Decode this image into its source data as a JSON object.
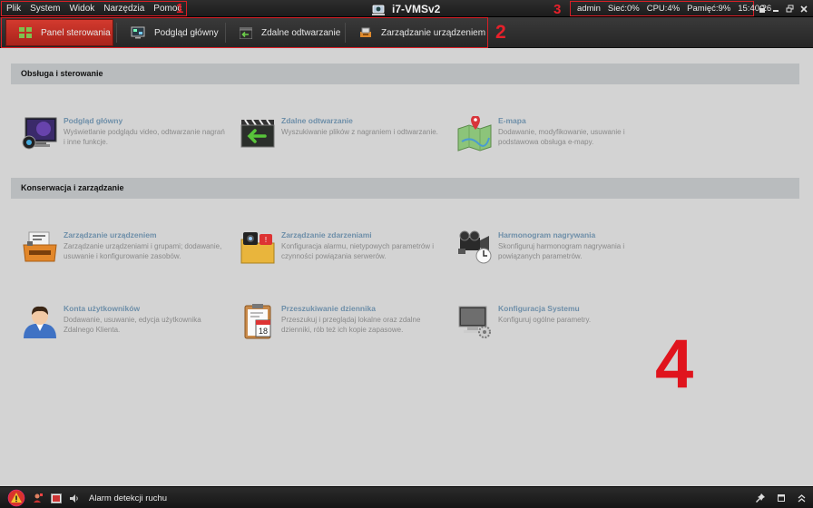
{
  "menu": {
    "items": [
      "Plik",
      "System",
      "Widok",
      "Narzędzia",
      "Pomoc"
    ],
    "annotation": "1"
  },
  "app": {
    "title": "i7-VMSv2"
  },
  "status": {
    "annotation": "3",
    "user": "admin",
    "net": "Sieć:0%",
    "cpu": "CPU:4%",
    "mem": "Pamięć:9%",
    "time": "15:40:26"
  },
  "window_controls": {
    "lock_icon": "lock-icon",
    "minimize_icon": "minimize-icon",
    "restore_icon": "restore-icon",
    "close_icon": "close-icon"
  },
  "tabs": {
    "annotation": "2",
    "items": [
      {
        "label": "Panel sterowania",
        "icon": "grid-icon",
        "active": true
      },
      {
        "label": "Podgląd główny",
        "icon": "monitor-icon",
        "active": false
      },
      {
        "label": "Zdalne odtwarzanie",
        "icon": "playback-icon",
        "active": false
      },
      {
        "label": "Zarządzanie urządzeniem",
        "icon": "device-icon",
        "active": false
      }
    ],
    "active_color": "#c0302a"
  },
  "sections": [
    {
      "title": "Obsługa i sterowanie",
      "items": [
        {
          "title": "Podgląd główny",
          "desc": "Wyświetlanie podglądu video, odtwarzanie nagrań i inne funkcje.",
          "icon": "live-view-icon"
        },
        {
          "title": "Zdalne odtwarzanie",
          "desc": "Wyszukiwanie plików z nagraniem i odtwarzanie.",
          "icon": "remote-playback-icon"
        },
        {
          "title": "E-mapa",
          "desc": "Dodawanie, modyfikowanie, usuwanie i podstawowa obsługa e-mapy.",
          "icon": "emap-icon"
        }
      ]
    },
    {
      "title": "Konserwacja i zarządzanie",
      "items": [
        {
          "title": "Zarządzanie urządzeniem",
          "desc": "Zarządzanie urządzeniami i grupami; dodawanie, usuwanie i konfigurowanie zasobów.",
          "icon": "device-management-icon"
        },
        {
          "title": "Zarządzanie zdarzeniami",
          "desc": "Konfiguracja alarmu, nietypowych parametrów i czynności powiązania serwerów.",
          "icon": "event-management-icon"
        },
        {
          "title": "Harmonogram nagrywania",
          "desc": "Skonfiguruj harmonogram nagrywania i powiązanych parametrów.",
          "icon": "record-schedule-icon"
        },
        {
          "title": "Konta użytkowników",
          "desc": "Dodawanie, usuwanie, edycja użytkownika Zdalnego Klienta.",
          "icon": "user-accounts-icon"
        },
        {
          "title": "Przeszukiwanie dziennika",
          "desc": "Przeszukuj i przeglądaj lokalne oraz zdalne dzienniki, rób też ich kopie zapasowe.",
          "icon": "log-search-icon"
        },
        {
          "title": "Konfiguracja Systemu",
          "desc": "Konfiguruj ogólne parametry.",
          "icon": "system-config-icon"
        }
      ]
    }
  ],
  "main_annotation": "4",
  "bottom": {
    "alarm_text": "Alarm detekcji ruchu",
    "icons": [
      "alarm-icon",
      "alarm-person-icon",
      "video-alarm-icon",
      "speaker-icon",
      "pin-icon",
      "window-icon",
      "collapse-icon"
    ]
  }
}
